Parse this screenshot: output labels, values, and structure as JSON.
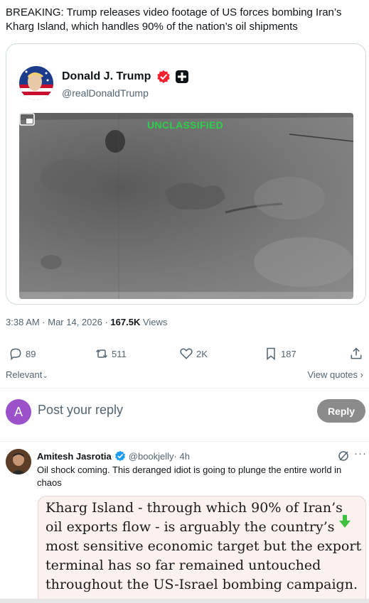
{
  "headline": "BREAKING: Trump releases video footage of US forces bombing Iran’s Kharg Island, which handles 90% of the nation’s oil shipments",
  "quoted_post": {
    "author_name": "Donald J. Trump",
    "author_handle": "@realDonaldTrump",
    "video_overlay_text": "UNCLASSIFIED"
  },
  "meta": {
    "time": "3:38 AM · Mar 14, 2026 · ",
    "views_count": "167.5K",
    "views_label": " Views"
  },
  "actions": {
    "replies": "89",
    "reposts": "511",
    "likes": "2K",
    "bookmarks": "187"
  },
  "sort": {
    "relevant_label": "Relevant",
    "view_quotes_label": "View quotes"
  },
  "composer": {
    "avatar_letter": "A",
    "placeholder": "Post your reply",
    "button_label": "Reply"
  },
  "comment": {
    "author_name": "Amitesh Jasrotia",
    "author_handle": "@bookjelly",
    "time": " · 4h",
    "text": "Oil shock coming. This deranged idiot is going to plunge the entire world in chaos",
    "article_excerpt": "Kharg Island - through which 90% of Iran’s oil exports flow - is arguably the country’s most sensitive economic target but the export terminal has so far remained untouched throughout the US-Israel bombing campaign."
  },
  "colors": {
    "verified": "#f4212e",
    "comment_verified": "#1d9bf0",
    "composer_avatar": "#9b51c9",
    "overlay_green": "#2bd14a"
  }
}
